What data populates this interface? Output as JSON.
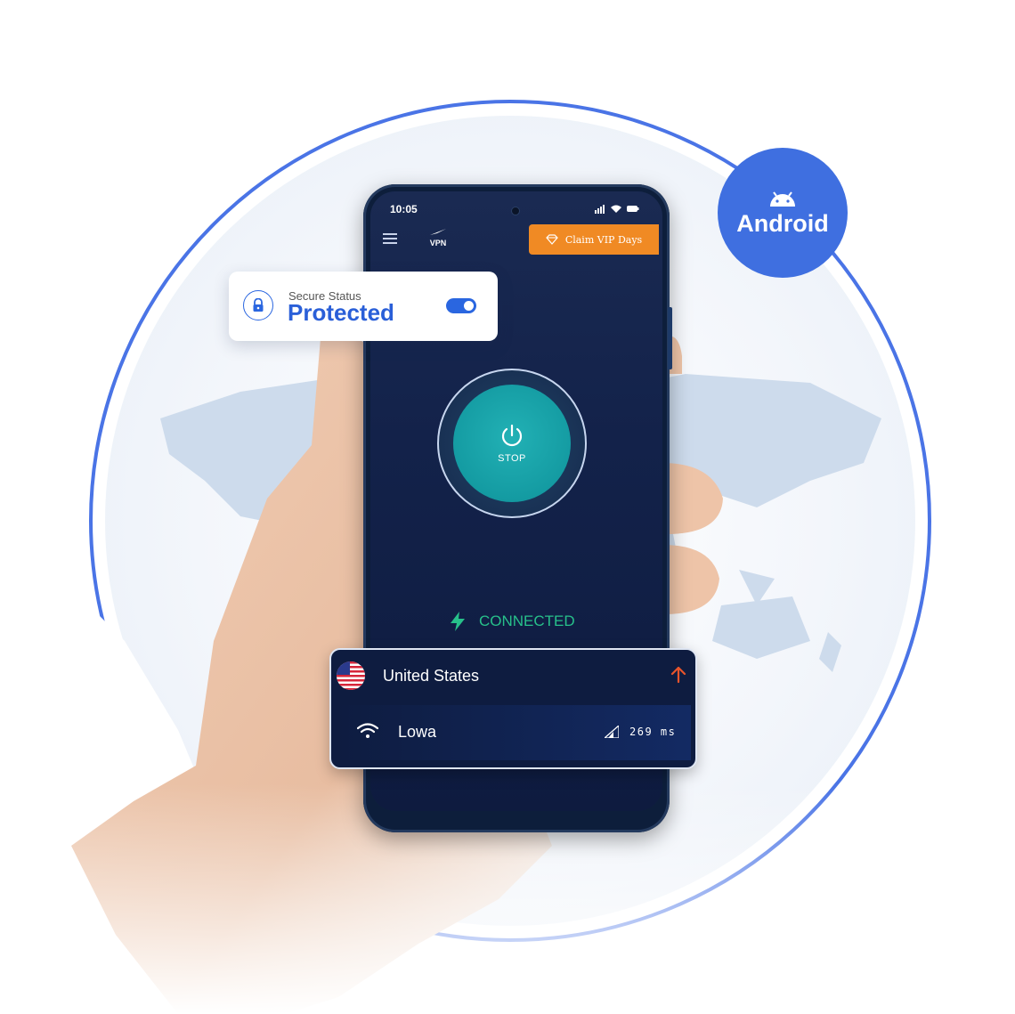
{
  "badge": {
    "platform": "Android",
    "icon": "android-icon"
  },
  "status_bar": {
    "time": "10:05",
    "icons": [
      "signal-icon",
      "wifi-icon",
      "battery-icon"
    ]
  },
  "app_header": {
    "menu_icon": "hamburger-icon",
    "logo_text": "VPN",
    "vip_label": "Claim VIP Days",
    "vip_icon": "diamond-icon"
  },
  "power": {
    "label": "STOP",
    "icon": "power-icon"
  },
  "connection": {
    "status": "CONNECTED",
    "icon": "lightning-icon",
    "color": "#27c08a"
  },
  "secure_card": {
    "caption": "Secure Status",
    "status": "Protected",
    "toggle_on": true,
    "accent": "#2a5fd8"
  },
  "location_card": {
    "country": "United States",
    "city": "Lowa",
    "ping": "269 ms",
    "arrow_color": "#e8542b"
  }
}
